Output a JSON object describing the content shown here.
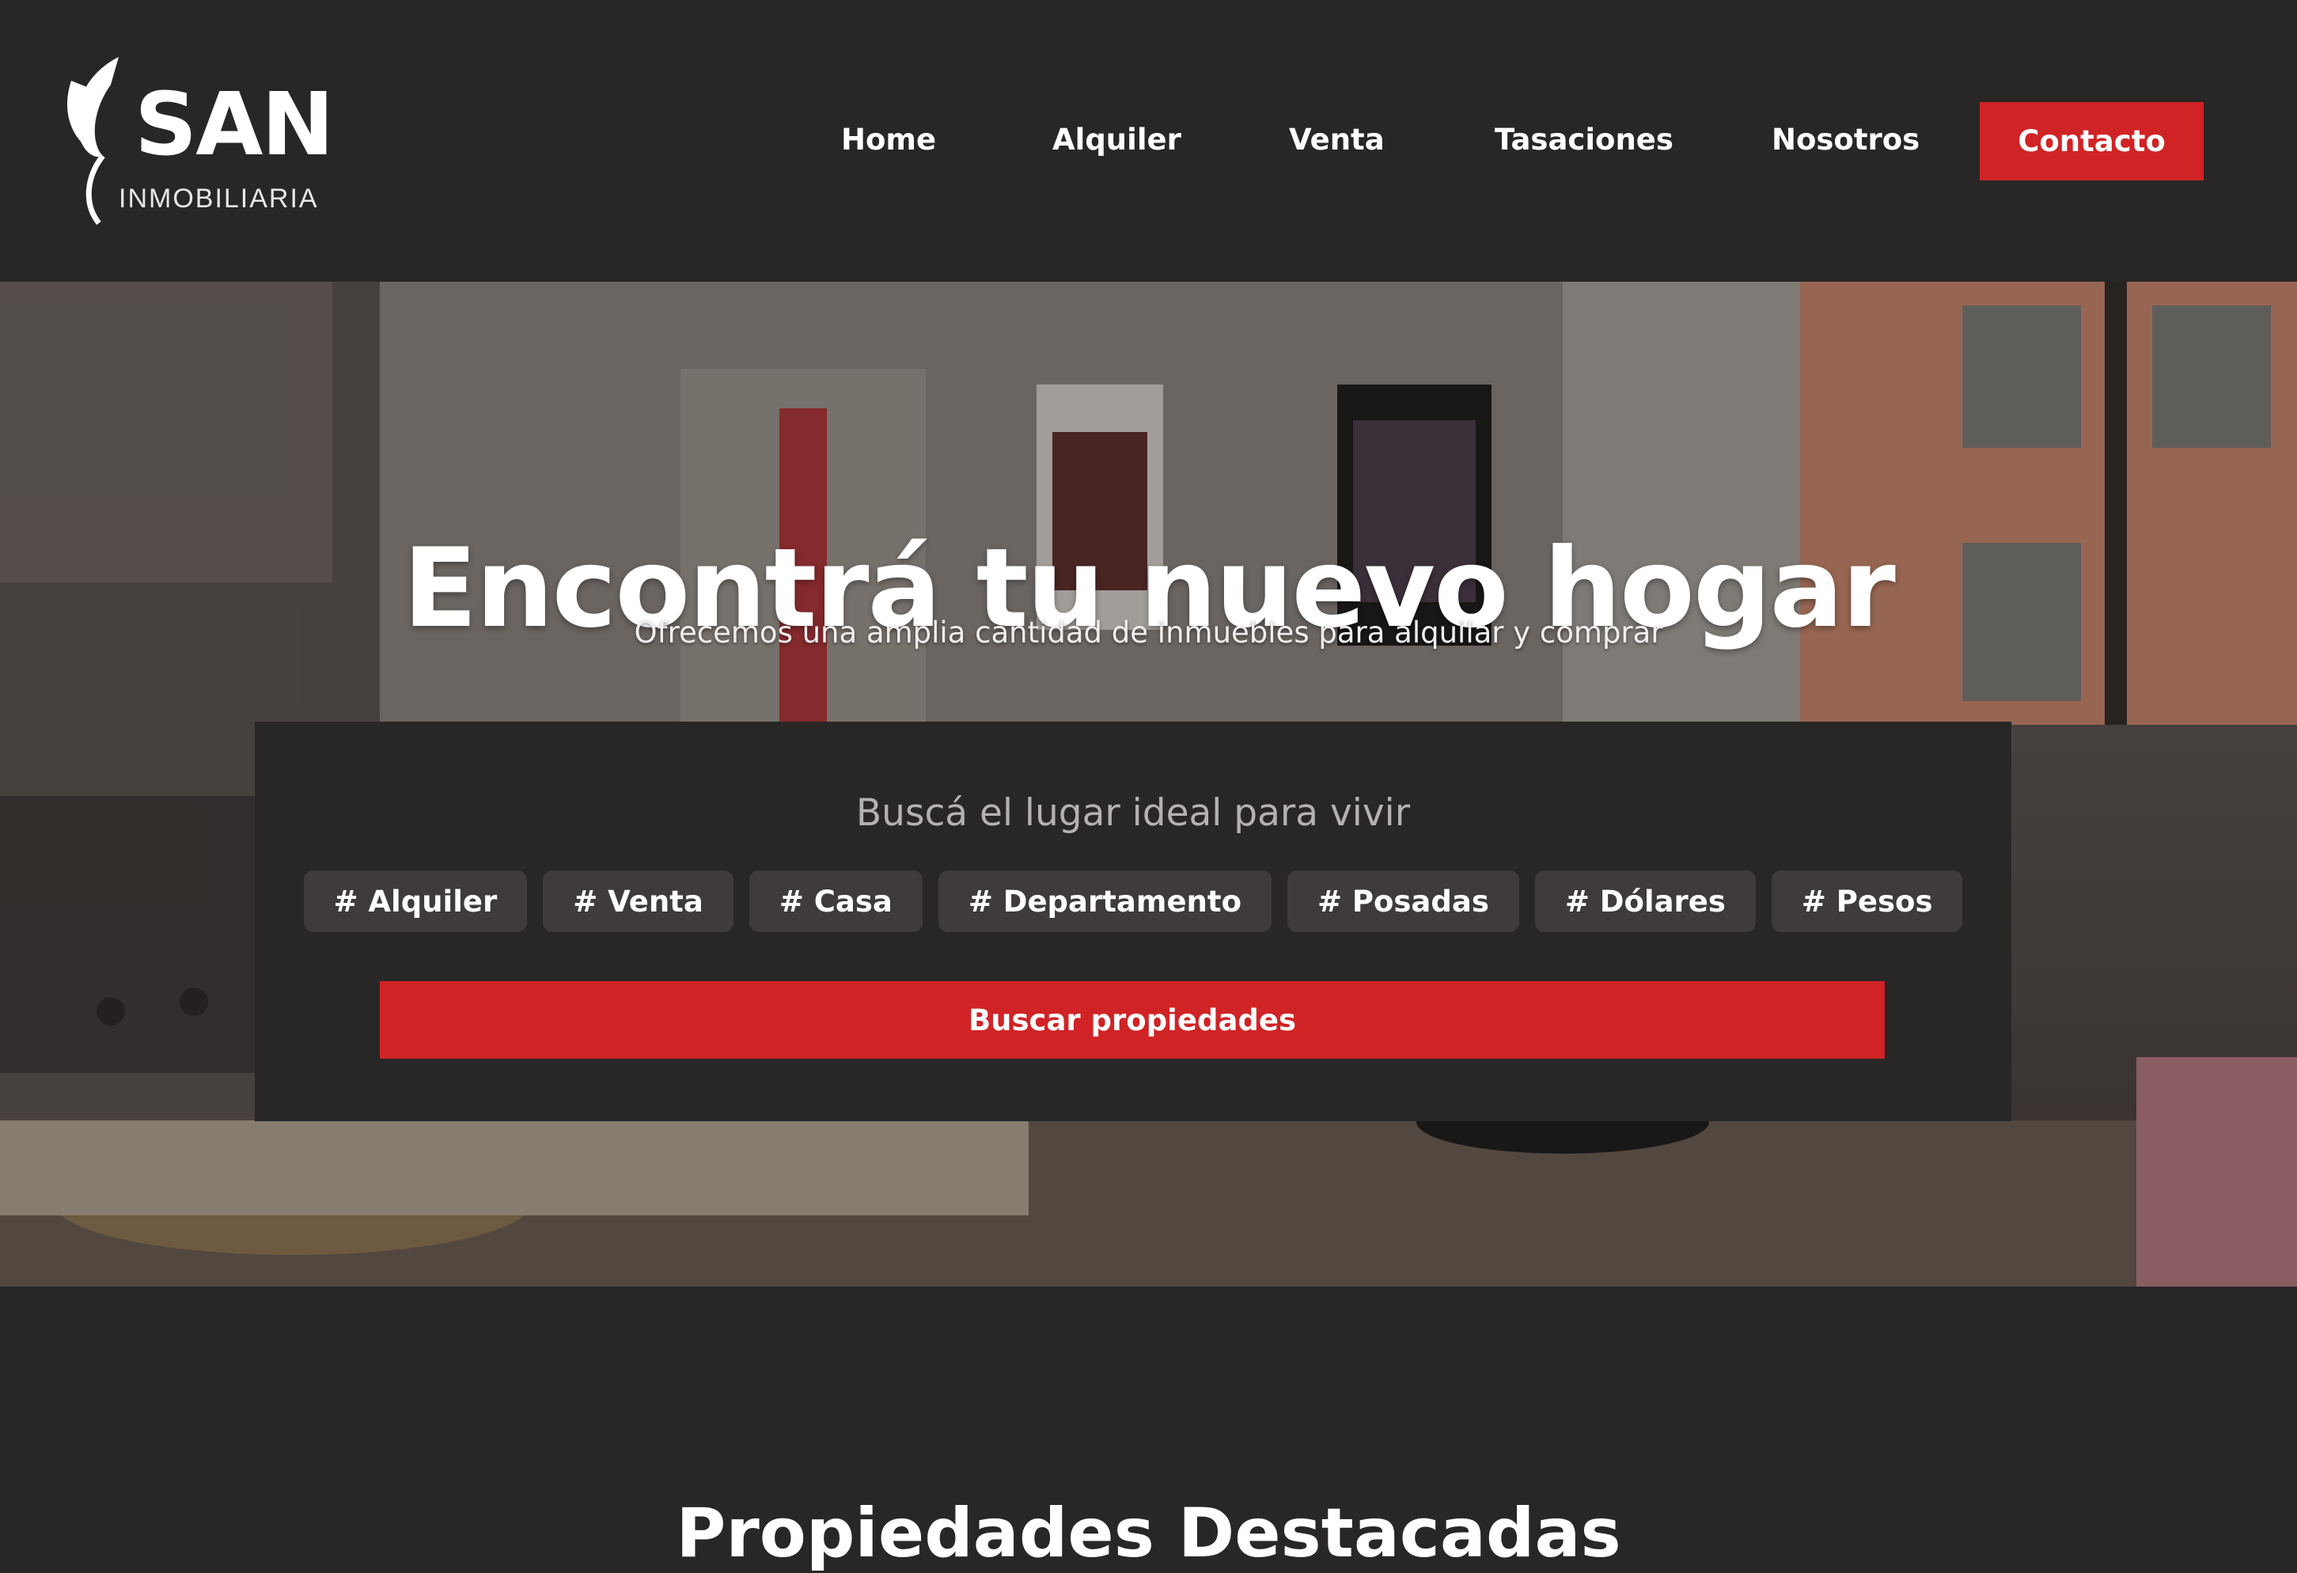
{
  "brand": {
    "name": "SAN",
    "subtitle": "INMOBILIARIA",
    "accent": "#d02325",
    "background": "#292626"
  },
  "nav": {
    "items": [
      "Home",
      "Alquiler",
      "Venta",
      "Tasaciones",
      "Nosotros"
    ],
    "cta": "Contacto"
  },
  "hero": {
    "title": "Encontrá tu nuevo hogar",
    "subtitle": "Ofrecemos una amplia cantidad de inmuebles para alquilar y comprar"
  },
  "search": {
    "title": "Buscá el lugar ideal para vivir",
    "tags": [
      "# Alquiler",
      "# Venta",
      "# Casa",
      "# Departamento",
      "# Posadas",
      "# Dólares",
      "# Pesos"
    ],
    "button": "Buscar propiedades"
  },
  "featured": {
    "title": "Propiedades Destacadas"
  }
}
